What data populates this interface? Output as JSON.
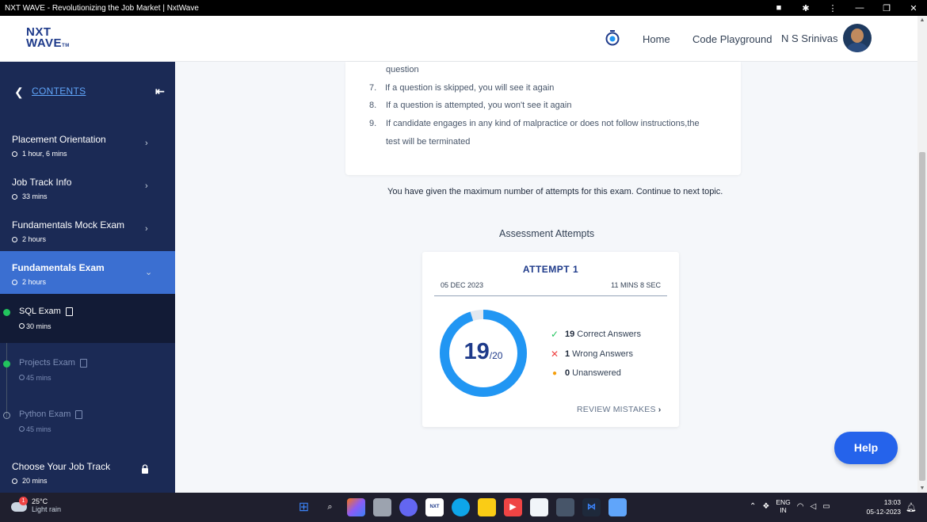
{
  "window": {
    "title": "NXT WAVE - Revolutionizing the Job Market | NxtWave",
    "controls": [
      "—",
      "❐",
      "✕"
    ]
  },
  "header": {
    "logo_line1": "NXT",
    "logo_line2": "WAVE",
    "logo_tm": "TM",
    "nav": {
      "home": "Home",
      "code_playground": "Code Playground",
      "user_name": "N S Srinivas"
    }
  },
  "sidebar": {
    "contents_label": "CONTENTS",
    "collapse_glyph": "⇤",
    "items": [
      {
        "title": "Placement Orientation",
        "duration": "1 hour, 6 mins"
      },
      {
        "title": "Job Track Info",
        "duration": "33 mins"
      },
      {
        "title": "Fundamentals Mock Exam",
        "duration": "2 hours"
      },
      {
        "title": "Fundamentals Exam",
        "duration": "2 hours"
      }
    ],
    "sub_items": [
      {
        "title": "SQL Exam",
        "duration": "30 mins",
        "status": "done"
      },
      {
        "title": "Projects Exam",
        "duration": "45 mins",
        "status": "done"
      },
      {
        "title": "Python Exam",
        "duration": "45 mins",
        "status": "open"
      }
    ],
    "locked_item": {
      "title": "Choose Your Job Track",
      "duration": "20 mins"
    }
  },
  "rules": [
    {
      "number": "",
      "text": "question"
    },
    {
      "number": "7.",
      "text": "If a question is skipped, you will see it again"
    },
    {
      "number": "8.",
      "text": "If a question is attempted, you won't see it again"
    },
    {
      "number": "9.",
      "text": "If candidate engages in any kind of malpractice or does  not follow instructions,the"
    },
    {
      "number": "",
      "text": "test will be terminated"
    }
  ],
  "message": "You have given the maximum number of attempts for this exam. Continue to next topic.",
  "attempts": {
    "section_title": "Assessment Attempts",
    "attempt_label": "ATTEMPT 1",
    "date": "05 DEC 2023",
    "time_taken": "11 MINS 8 SEC",
    "score": "19",
    "total": "/20",
    "score_fraction": 0.95,
    "correct_count": "19",
    "correct_label": "Correct Answers",
    "wrong_count": "1",
    "wrong_label": "Wrong Answers",
    "unanswered_count": "0",
    "unanswered_label": "Unanswered",
    "review_label": "REVIEW MISTAKES"
  },
  "help_label": "Help",
  "taskbar": {
    "temperature": "25°C",
    "weather": "Light rain",
    "weather_badge": "1",
    "lang_line1": "ENG",
    "lang_line2": "IN",
    "time": "13:03",
    "date": "05-12-2023"
  },
  "colors": {
    "accent": "#2196f3",
    "sidebar_bg": "#1b2a55",
    "active_item": "#3b6fd1",
    "correct": "#22c55e",
    "wrong": "#ef4444",
    "unanswered": "#f59e0b"
  }
}
